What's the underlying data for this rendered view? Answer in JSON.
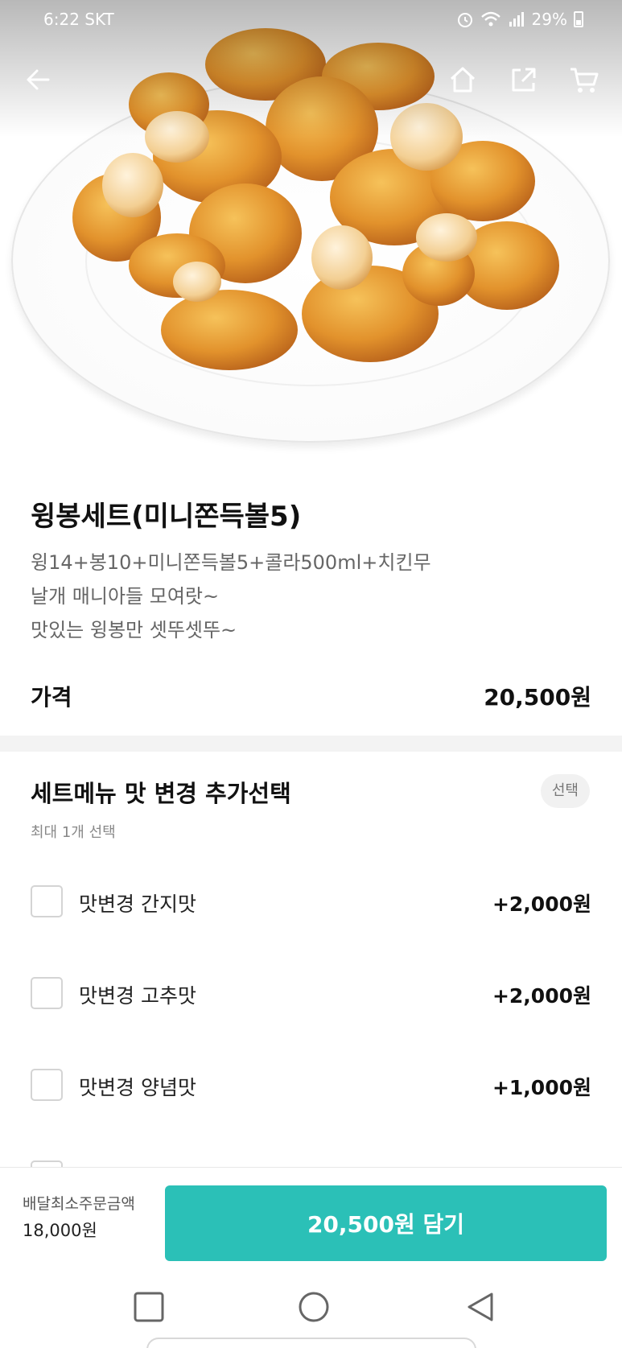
{
  "status_bar": {
    "time": "6:22",
    "carrier": "SKT",
    "battery": "29%"
  },
  "product": {
    "name": "윙봉세트(미니쫀득볼5)",
    "description": [
      "윙14+봉10+미니쫀득볼5+콜라500ml+치킨무",
      "날개 매니아들 모여랏~",
      "맛있는 윙봉만 셋뚜셋뚜~"
    ],
    "price_label": "가격",
    "price": "20,500원"
  },
  "options": {
    "title": "세트메뉴 맛 변경 추가선택",
    "badge": "선택",
    "subtitle": "최대 1개 선택",
    "items": [
      {
        "name": "맛변경 간지맛",
        "price": "+2,000원"
      },
      {
        "name": "맛변경 고추맛",
        "price": "+2,000원"
      },
      {
        "name": "맛변경 양념맛",
        "price": "+1,000원"
      }
    ]
  },
  "bottom_bar": {
    "min_order_label": "배달최소주문금액",
    "min_order_value": "18,000원",
    "cart_button": "20,500원 담기"
  },
  "colors": {
    "accent": "#2bc0b7",
    "divider": "#f3f3f3",
    "food": "#e0962e"
  },
  "icons": [
    "back-arrow-icon",
    "home-icon",
    "share-icon",
    "cart-icon",
    "alarm-icon",
    "wifi-icon",
    "signal-icon",
    "battery-icon",
    "recent-apps-icon",
    "home-circle-icon",
    "back-triangle-icon"
  ]
}
